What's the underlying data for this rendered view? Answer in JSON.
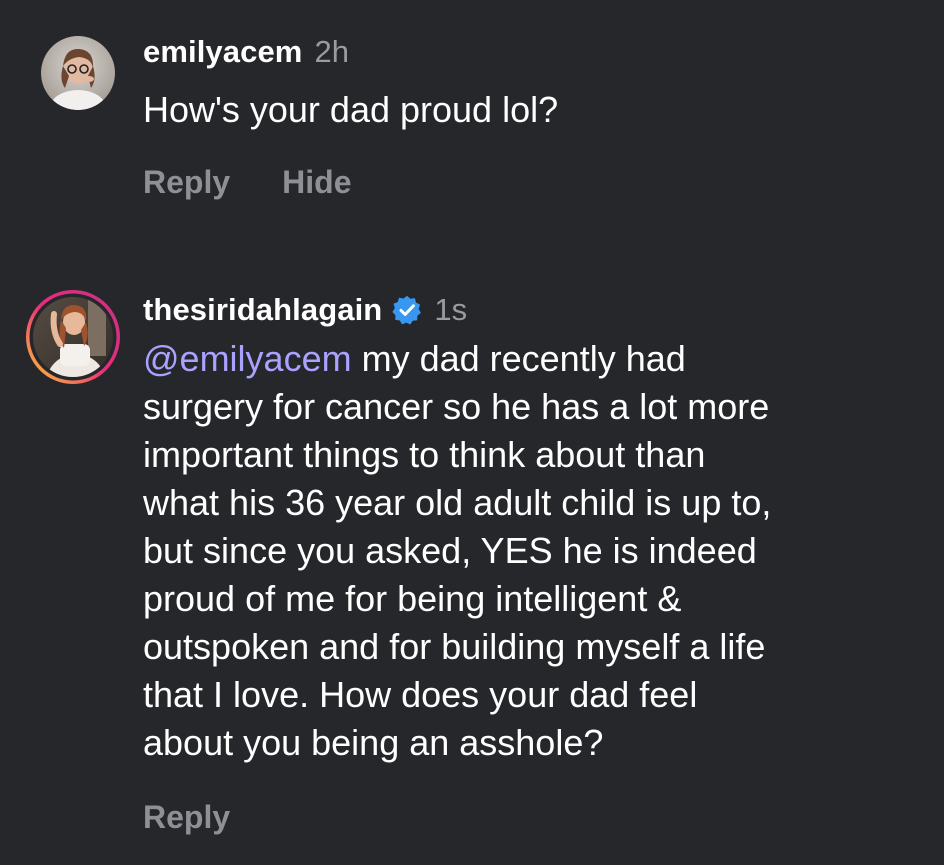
{
  "comments": [
    {
      "username": "emilyacem",
      "time": "2h",
      "text": "How's your dad proud lol?",
      "actions": {
        "reply": "Reply",
        "hide": "Hide"
      }
    },
    {
      "username": "thesiridahlagain",
      "time": "1s",
      "mention": "@emilyacem",
      "lines": [
        " my dad recently had",
        "surgery for cancer so he has a lot more",
        "important things to think about than",
        "what his 36 year old adult child is up to,",
        "but since you asked, YES he is indeed",
        "proud of me for being intelligent &",
        "outspoken and for building myself a life",
        "that I love. How does your dad feel",
        "about you being an asshole?"
      ],
      "actions": {
        "reply": "Reply"
      }
    }
  ],
  "colors": {
    "background": "#26272b",
    "mention": "#a9a2ff",
    "muted": "#9a9ba0",
    "verified": "#3897f0",
    "story_ring_start": "#f9ce34",
    "story_ring_mid": "#ee2a7b",
    "story_ring_end": "#c13584"
  },
  "icons": {
    "verified": "verified-badge-icon"
  }
}
